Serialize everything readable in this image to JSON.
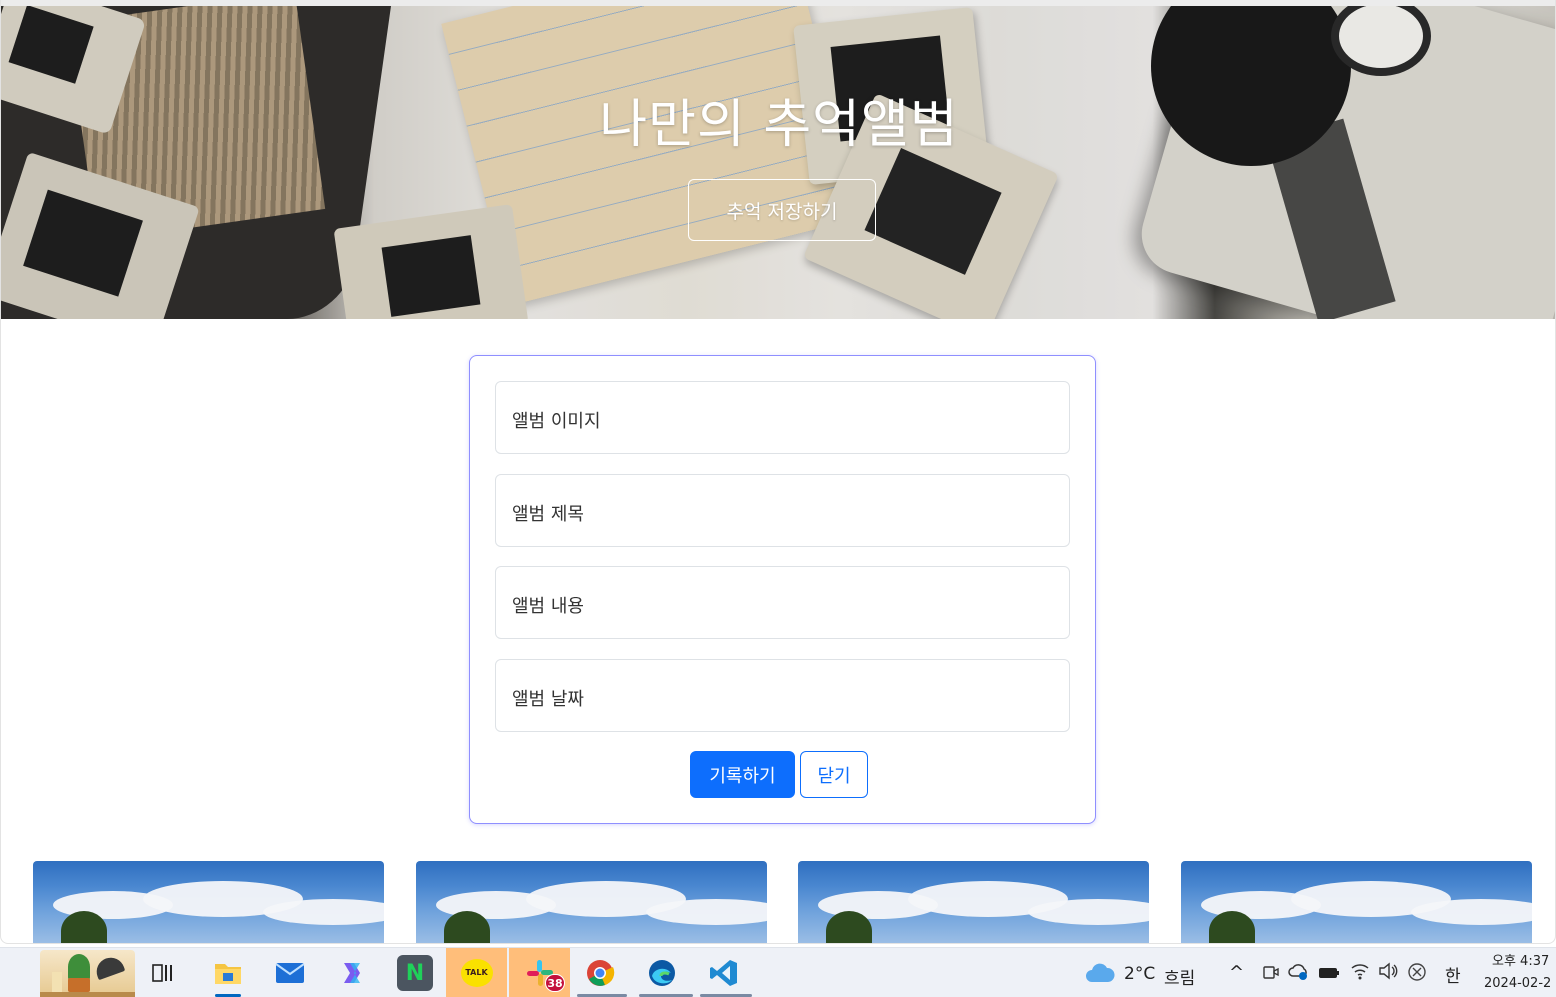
{
  "hero": {
    "title": "나만의 추억앨범",
    "button_label": "추억 저장하기"
  },
  "form": {
    "fields": [
      {
        "label": "앨범 이미지"
      },
      {
        "label": "앨범 제목"
      },
      {
        "label": "앨범 내용"
      },
      {
        "label": "앨범 날짜"
      }
    ],
    "submit_label": "기록하기",
    "close_label": "닫기"
  },
  "colors": {
    "primary": "#0d6efd",
    "card_border": "#8f8fff"
  },
  "taskbar": {
    "apps": [
      {
        "name": "task-view-icon"
      },
      {
        "name": "file-explorer-icon"
      },
      {
        "name": "mail-icon"
      },
      {
        "name": "copilot-icon"
      },
      {
        "name": "naver-icon",
        "glyph": "N"
      },
      {
        "name": "kakaotalk-icon",
        "glyph": "TALK"
      },
      {
        "name": "slack-icon",
        "badge": "38"
      },
      {
        "name": "chrome-icon"
      },
      {
        "name": "edge-icon"
      },
      {
        "name": "vscode-icon"
      }
    ],
    "weather_temp": "2°C",
    "weather_desc": "흐림",
    "ime": "한",
    "clock_time": "오후 4:37",
    "clock_date": "2024-02-2"
  }
}
